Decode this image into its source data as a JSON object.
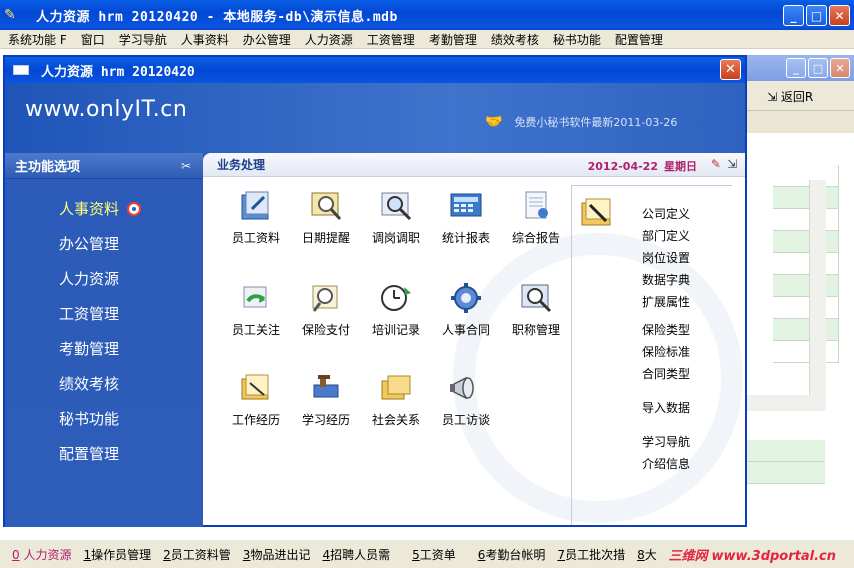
{
  "outer": {
    "title": "人力资源 hrm 20120420 - 本地服务-db\\演示信息.mdb"
  },
  "menubar": [
    "系统功能 F",
    "窗口",
    "学习导航",
    "人事资料",
    "办公管理",
    "人力资源",
    "工资管理",
    "考勤管理",
    "绩效考核",
    "秘书功能",
    "配置管理"
  ],
  "bg_window": {
    "back_label": "返回R"
  },
  "child": {
    "title": "人力资源 hrm 20120420",
    "logo": "www.onlyIT.cn",
    "news": "免费小秘书软件最新2011-03-26"
  },
  "side": {
    "header": "主功能选项",
    "items": [
      "人事资料",
      "办公管理",
      "人力资源",
      "工资管理",
      "考勤管理",
      "绩效考核",
      "秘书功能",
      "配置管理"
    ]
  },
  "work": {
    "title": "业务处理",
    "date": "2012-04-22",
    "weekday": "星期日",
    "icons": [
      {
        "label": "员工资料",
        "icon": "employee-file-icon"
      },
      {
        "label": "日期提醒",
        "icon": "date-reminder-icon"
      },
      {
        "label": "调岗调职",
        "icon": "job-transfer-icon"
      },
      {
        "label": "统计报表",
        "icon": "statistics-report-icon"
      },
      {
        "label": "综合报告",
        "icon": "summary-report-icon"
      },
      {
        "label": "员工关注",
        "icon": "employee-watch-icon"
      },
      {
        "label": "保险支付",
        "icon": "insurance-payment-icon"
      },
      {
        "label": "培训记录",
        "icon": "training-record-icon"
      },
      {
        "label": "人事合同",
        "icon": "personnel-contract-icon"
      },
      {
        "label": "职称管理",
        "icon": "title-management-icon"
      },
      {
        "label": "工作经历",
        "icon": "work-history-icon"
      },
      {
        "label": "学习经历",
        "icon": "study-history-icon"
      },
      {
        "label": "社会关系",
        "icon": "social-relation-icon"
      },
      {
        "label": "员工访谈",
        "icon": "employee-interview-icon"
      }
    ],
    "right_links_a": [
      "公司定义",
      "部门定义",
      "岗位设置",
      "数据字典",
      "扩展属性"
    ],
    "right_links_b": [
      "保险类型",
      "保险标准",
      "合同类型"
    ],
    "right_links_c": [
      "导入数据"
    ],
    "right_links_d": [
      "学习导航",
      "介绍信息"
    ]
  },
  "bottom_bar": [
    {
      "n": "0",
      "label": "人力资源"
    },
    {
      "n": "1",
      "label": "操作员管理"
    },
    {
      "n": "2",
      "label": "员工资料管"
    },
    {
      "n": "3",
      "label": "物品进出记"
    },
    {
      "n": "4",
      "label": "招聘人员需"
    },
    {
      "n": "5",
      "label": "工资单"
    },
    {
      "n": "6",
      "label": "考勤台帐明"
    },
    {
      "n": "7",
      "label": "员工批次措"
    },
    {
      "n": "8",
      "label": "大"
    }
  ],
  "brand_watermark": {
    "name": "三维网",
    "url": "www.3dportal.cn"
  }
}
